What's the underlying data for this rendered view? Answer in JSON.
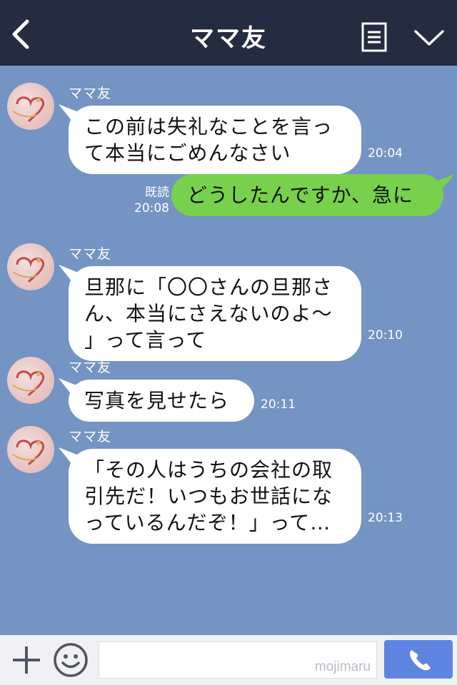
{
  "header": {
    "title": "ママ友"
  },
  "messages": [
    {
      "sender": "ママ友",
      "text": "この前は失礼なことを言っ\nて本当にごめんなさい",
      "time": "20:04"
    },
    {
      "text": "どうしたんですか、急に",
      "read_label": "既読",
      "time": "20:08"
    },
    {
      "sender": "ママ友",
      "text": "旦那に「〇〇さんの旦那さ\nん、本当にさえないのよ〜\n」って言って",
      "time": "20:10"
    },
    {
      "sender": "ママ友",
      "text": "写真を見せたら",
      "time": "20:11"
    },
    {
      "sender": "ママ友",
      "text": "「その人はうちの会社の取\n引先だ！いつもお世話にな\nっているんだぞ！」って…",
      "time": "20:13"
    }
  ],
  "input": {
    "placeholder": "",
    "watermark": "mojimaru"
  },
  "colors": {
    "header_bg": "#232c40",
    "chat_bg": "#7494c3",
    "outgoing_bubble": "#78d14c",
    "incoming_bubble": "#ffffff",
    "call_button": "#5f85e2"
  },
  "icons": {
    "back": "chevron-left-icon",
    "menu": "document-list-icon",
    "expand": "chevron-down-icon",
    "add": "plus-icon",
    "emoji": "smiley-icon",
    "call": "phone-icon"
  }
}
